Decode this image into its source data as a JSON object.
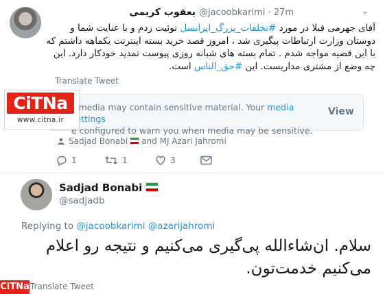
{
  "tweet1": {
    "display_name": "یعقوب کریمی",
    "handle_time": "@jacoobkarimi · 27m",
    "body_lines": [
      {
        "pre": "آقای جهرمی قبلا در مورد ",
        "hashtag": "#تخلفات_بزرگ_ایرانسل",
        "post": " توئیت زدم و با عنایت شما و"
      },
      {
        "pre": "دوستان وزارت ارتباطات پیگیری شد ، امروز قصد خرید بسته اینترنت یکماهه داشتم که",
        "hashtag": "",
        "post": ""
      },
      {
        "pre": "با این قضیه مواجه شدم . تمام بسته های شبانه روزی پیوست تمدید خودکار دارد. این",
        "hashtag": "",
        "post": ""
      },
      {
        "pre": "چه وضع از مشتری مداریست. این ",
        "hashtag": "#حق_الناس",
        "post": " است."
      }
    ],
    "translate_label": "Translate Tweet",
    "sensitive": {
      "text_prefix": "s media may contain sensitive material. Your ",
      "link_text": "media settings",
      "text_line2": "e configured to warn you when media may be sensitive.",
      "view_label": "View"
    },
    "tagged_text_a": "Sadjad Bonabi",
    "tagged_text_b": "and MJ Azari Jahromi",
    "actions": {
      "reply_count": "1",
      "retweet_count": "1",
      "like_count": "3"
    },
    "more_icon": "chevron-down-icon"
  },
  "logo": {
    "word": "CiTNa",
    "url": "www.citna.ir"
  },
  "tweet2": {
    "display_name": "Sadjad Bonabi",
    "handle": "@sadjadb",
    "replying_prefix": "Replying to ",
    "replying_to_1": "@jacoobkarimi",
    "replying_to_2": "@azarijahromi",
    "body_line1": "سلام. ان‌شاءالله پی‌گیری می‌کنیم و نتیجه رو اعلام",
    "body_line2": "می‌کنیم خدمت‌تون.",
    "translate_label": "Translate Tweet"
  },
  "logo_small": {
    "word": "CiTNa"
  },
  "colors": {
    "link": "#1b95e0",
    "muted": "#657786",
    "brand_red": "#e2231a",
    "divider": "#e6ecf0"
  }
}
